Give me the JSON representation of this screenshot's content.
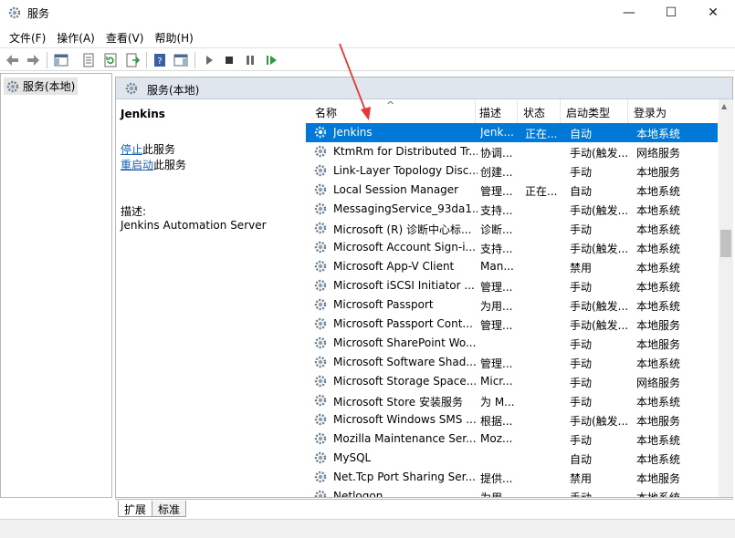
{
  "window": {
    "title": "服务",
    "app_icon": "gear-icon",
    "controls": {
      "minimize": "—",
      "maximize": "☐",
      "close": "✕"
    }
  },
  "menu": [
    "文件(F)",
    "操作(A)",
    "查看(V)",
    "帮助(H)"
  ],
  "toolbar": {
    "buttons": [
      "back-arrow-icon",
      "forward-arrow-icon",
      "show-console-tree-icon",
      "properties-icon",
      "refresh-icon",
      "export-list-icon",
      "help-icon",
      "show-action-pane-icon",
      "play-icon",
      "stop-icon",
      "pause-icon",
      "restart-icon"
    ]
  },
  "tree": {
    "item_label": "服务(本地)",
    "item_icon": "gear-icon"
  },
  "main_header": {
    "label": "服务(本地)"
  },
  "details": {
    "service_name": "Jenkins",
    "stop_link": "停止",
    "stop_suffix": "此服务",
    "restart_link": "重启动",
    "restart_suffix": "此服务",
    "description_label": "描述:",
    "description": "Jenkins Automation Server"
  },
  "list": {
    "columns": [
      "名称",
      "描述",
      "状态",
      "启动类型",
      "登录为"
    ],
    "sort_indicator": "^",
    "rows": [
      {
        "name": "Jenkins",
        "desc": "Jenk...",
        "status": "正在...",
        "startup": "自动",
        "logon": "本地系统",
        "selected": true
      },
      {
        "name": "KtmRm for Distributed Tr...",
        "desc": "协调...",
        "status": "",
        "startup": "手动(触发...",
        "logon": "网络服务"
      },
      {
        "name": "Link-Layer Topology Disc...",
        "desc": "创建...",
        "status": "",
        "startup": "手动",
        "logon": "本地服务"
      },
      {
        "name": "Local Session Manager",
        "desc": "管理...",
        "status": "正在...",
        "startup": "自动",
        "logon": "本地系统"
      },
      {
        "name": "MessagingService_93da1...",
        "desc": "支持...",
        "status": "",
        "startup": "手动(触发...",
        "logon": "本地系统"
      },
      {
        "name": "Microsoft (R) 诊断中心标...",
        "desc": "诊断...",
        "status": "",
        "startup": "手动",
        "logon": "本地系统"
      },
      {
        "name": "Microsoft Account Sign-i...",
        "desc": "支持...",
        "status": "",
        "startup": "手动(触发...",
        "logon": "本地系统"
      },
      {
        "name": "Microsoft App-V Client",
        "desc": "Man...",
        "status": "",
        "startup": "禁用",
        "logon": "本地系统"
      },
      {
        "name": "Microsoft iSCSI Initiator ...",
        "desc": "管理...",
        "status": "",
        "startup": "手动",
        "logon": "本地系统"
      },
      {
        "name": "Microsoft Passport",
        "desc": "为用...",
        "status": "",
        "startup": "手动(触发...",
        "logon": "本地系统"
      },
      {
        "name": "Microsoft Passport Cont...",
        "desc": "管理...",
        "status": "",
        "startup": "手动(触发...",
        "logon": "本地服务"
      },
      {
        "name": "Microsoft SharePoint Wo...",
        "desc": "",
        "status": "",
        "startup": "手动",
        "logon": "本地服务"
      },
      {
        "name": "Microsoft Software Shad...",
        "desc": "管理...",
        "status": "",
        "startup": "手动",
        "logon": "本地系统"
      },
      {
        "name": "Microsoft Storage Space...",
        "desc": "Micr...",
        "status": "",
        "startup": "手动",
        "logon": "网络服务"
      },
      {
        "name": "Microsoft Store 安装服务",
        "desc": "为 M...",
        "status": "",
        "startup": "手动",
        "logon": "本地系统"
      },
      {
        "name": "Microsoft Windows SMS ...",
        "desc": "根据...",
        "status": "",
        "startup": "手动(触发...",
        "logon": "本地服务"
      },
      {
        "name": "Mozilla Maintenance Ser...",
        "desc": "Moz...",
        "status": "",
        "startup": "手动",
        "logon": "本地系统"
      },
      {
        "name": "MySQL",
        "desc": "",
        "status": "",
        "startup": "自动",
        "logon": "本地系统"
      },
      {
        "name": "Net.Tcp Port Sharing Ser...",
        "desc": "提供...",
        "status": "",
        "startup": "禁用",
        "logon": "本地服务"
      },
      {
        "name": "Netlogon",
        "desc": "为用...",
        "status": "",
        "startup": "手动",
        "logon": "本地系统"
      }
    ]
  },
  "tabs": [
    "扩展",
    "标准"
  ],
  "colors": {
    "selection": "#0078d7",
    "annotation_arrow": "#e53935",
    "header_band": "#dfe6ee"
  }
}
